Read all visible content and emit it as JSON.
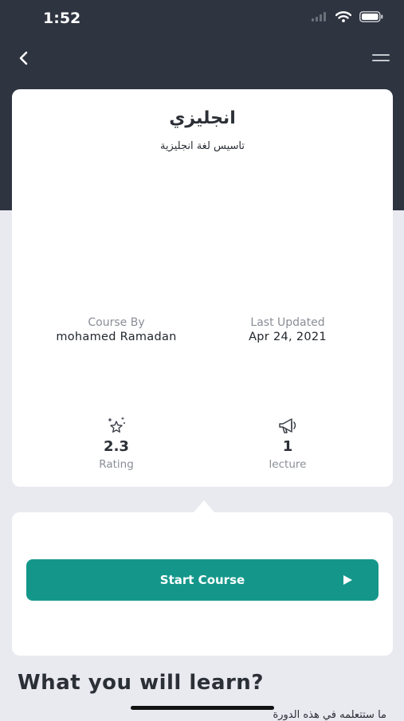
{
  "status_bar": {
    "time": "1:52"
  },
  "course": {
    "title": "انجليزي",
    "subtitle": "تاسيس لغة انجليزية"
  },
  "meta": {
    "course_by_label": "Course By",
    "course_by_value": "mohamed Ramadan",
    "updated_label": "Last Updated",
    "updated_value": "Apr 24, 2021"
  },
  "stats": {
    "rating_value": "2.3",
    "rating_label": "Rating",
    "lecture_value": "1",
    "lecture_label": "lecture"
  },
  "action": {
    "start_label": "Start Course"
  },
  "learn": {
    "heading": "What you will learn?",
    "first_item_partial": "ما ستتعلمه في هذه الدورة"
  },
  "colors": {
    "header_bg": "#2e3440",
    "page_bg": "#e9e9f0",
    "accent": "#14978a"
  },
  "icons": {
    "back": "chevron-left-icon",
    "menu": "hamburger-icon",
    "rating": "star-sparkle-icon",
    "lecture": "megaphone-icon",
    "play": "play-icon"
  }
}
